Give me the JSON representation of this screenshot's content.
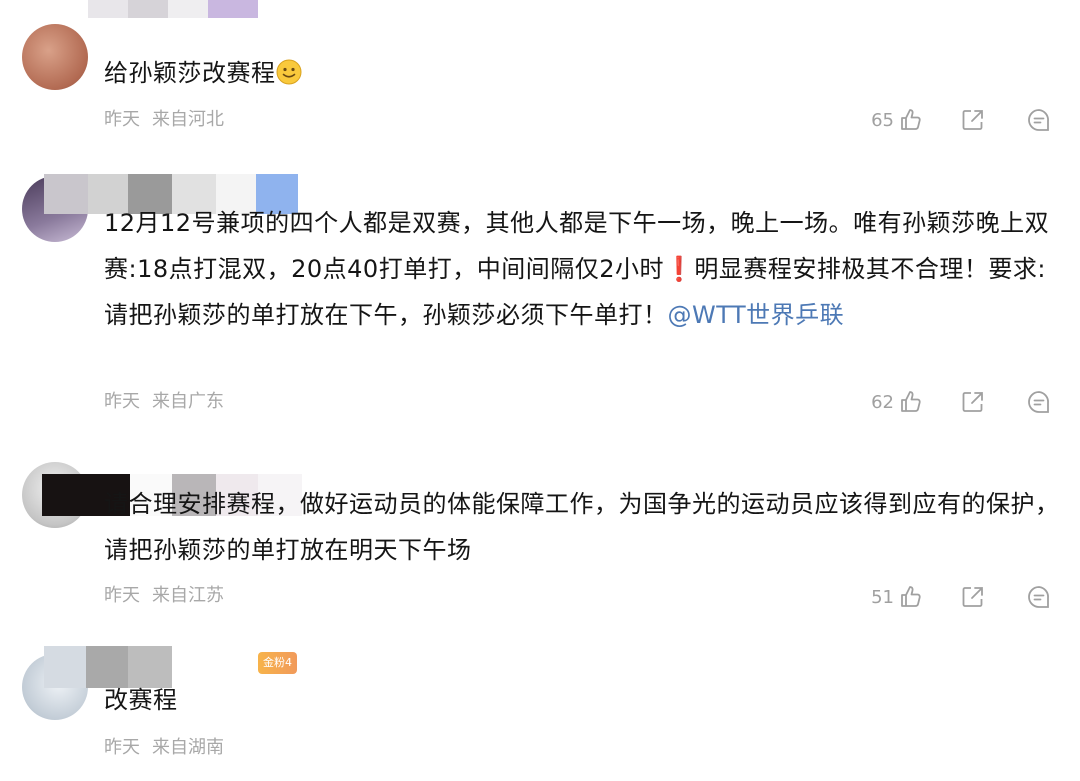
{
  "comments": [
    {
      "text": "给孙颖莎改赛程",
      "date": "昨天",
      "location": "来自河北",
      "likes": "65"
    },
    {
      "text_part1": "12月12号兼项的四个人都是双赛，其他人都是下午一场，晚上一场。唯有孙颖莎晚上双赛:18点打混双，20点40打单打，中间间隔仅2小时",
      "warn_mark": "❗",
      "text_part2": "明显赛程安排极其不合理！要求:请把孙颖莎的单打放在下午，孙颖莎必须下午单打！",
      "mention": "@WTT世界乒联",
      "date": "昨天",
      "location": "来自广东",
      "likes": "62"
    },
    {
      "text": "请合理安排赛程，做好运动员的体能保障工作，为国争光的运动员应该得到应有的保护，请把孙颖莎的单打放在明天下午场",
      "date": "昨天",
      "location": "来自江苏",
      "likes": "51"
    },
    {
      "text": "改赛程",
      "badge": "金粉4",
      "date": "昨天",
      "location": "来自湖南"
    }
  ],
  "colors": {
    "text": "#151515",
    "meta": "#a8a8a8",
    "mention": "#4d79b5",
    "warn": "#e23b35",
    "icon": "#a0a0a0"
  },
  "icons": [
    "like-icon",
    "share-icon",
    "comment-icon",
    "smile-emoji"
  ]
}
